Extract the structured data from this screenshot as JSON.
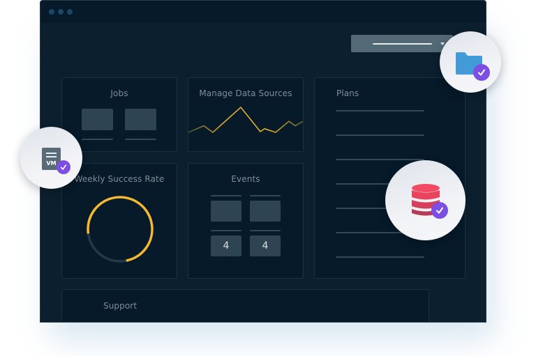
{
  "window": {
    "dots": [
      "dot-1",
      "dot-2",
      "dot-3"
    ],
    "dropdown": {
      "selected_value": "",
      "icon": "chevron-down-icon"
    }
  },
  "panels": {
    "jobs": {
      "title": "Jobs"
    },
    "data_sources": {
      "title": "Manage Data Sources",
      "sparkline": {
        "type": "line",
        "color": "#e0b030",
        "values": [
          3,
          12,
          3,
          37,
          4,
          8,
          3,
          18,
          12,
          19
        ]
      }
    },
    "plans": {
      "title": "Plans",
      "item_count": 7
    },
    "success_rate": {
      "title": "Weekly Success Rate",
      "progress_fraction": 0.74,
      "fill_color": "#f5b82e",
      "track_color": "#243848"
    },
    "events": {
      "title": "Events",
      "values": [
        "4",
        "4"
      ]
    },
    "support": {
      "title": "Support"
    }
  },
  "badges": [
    {
      "name": "folder",
      "icon": "folder-icon",
      "color": "#429bd6",
      "status": "check-icon"
    },
    {
      "name": "vm",
      "icon": "vm-document-icon",
      "label": "VM",
      "color": "#5a6b78",
      "status": "check-icon"
    },
    {
      "name": "database",
      "icon": "database-icon",
      "color": "#ef4b66",
      "status": "check-icon"
    }
  ],
  "colors": {
    "accent_purple": "#7c4ee4",
    "background": "#0c1f2e"
  }
}
